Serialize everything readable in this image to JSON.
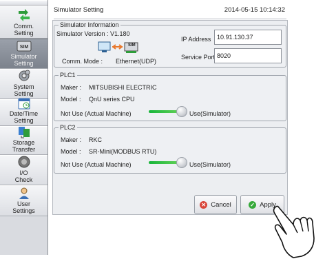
{
  "sidebar": {
    "items": [
      {
        "label": "Comm.\nSetting",
        "icon": "network-settings-icon"
      },
      {
        "label": "Simulator\nSetting",
        "icon": "simulator-icon"
      },
      {
        "label": "System\nSetting",
        "icon": "gear-icon"
      },
      {
        "label": "Date/Time\nSetting",
        "icon": "calendar-icon"
      },
      {
        "label": "Storage\nTransfer",
        "icon": "storage-transfer-icon"
      },
      {
        "label": "I/O\nCheck",
        "icon": "io-check-icon"
      },
      {
        "label": "User\nSettings",
        "icon": "user-icon"
      }
    ],
    "active_index": 1
  },
  "header": {
    "title": "Simulator Setting",
    "datetime": "2014-05-15 10:14:32"
  },
  "sim_info": {
    "group_title": "Simulator Information",
    "version_label": "Simulator Version :",
    "version_value": "V1.180",
    "sim_badge": "SIM",
    "comm_mode_label": "Comm. Mode :",
    "comm_mode_value": "Ethernet(UDP)",
    "ip_label": "IP Address",
    "ip_value": "10.91.130.37",
    "port_label": "Service Port",
    "port_value": "8020"
  },
  "plc1": {
    "group_title": "PLC1",
    "maker_label": "Maker :",
    "maker_value": "MITSUBISHI ELECTRIC",
    "model_label": "Model :",
    "model_value": "QnU series CPU",
    "left_label": "Not Use (Actual Machine)",
    "right_label": "Use(Simulator)",
    "toggle_state": "Use(Simulator)"
  },
  "plc2": {
    "group_title": "PLC2",
    "maker_label": "Maker :",
    "maker_value": "RKC",
    "model_label": "Model :",
    "model_value": "SR-Mini(MODBUS RTU)",
    "left_label": "Not Use (Actual Machine)",
    "right_label": "Use(Simulator)",
    "toggle_state": "Use(Simulator)"
  },
  "buttons": {
    "cancel": "Cancel",
    "apply": "Apply"
  },
  "colors": {
    "accent_green": "#2fbf3a",
    "cancel_red": "#d9463a",
    "apply_green": "#36a93a",
    "active_sidebar": "#868c95"
  }
}
